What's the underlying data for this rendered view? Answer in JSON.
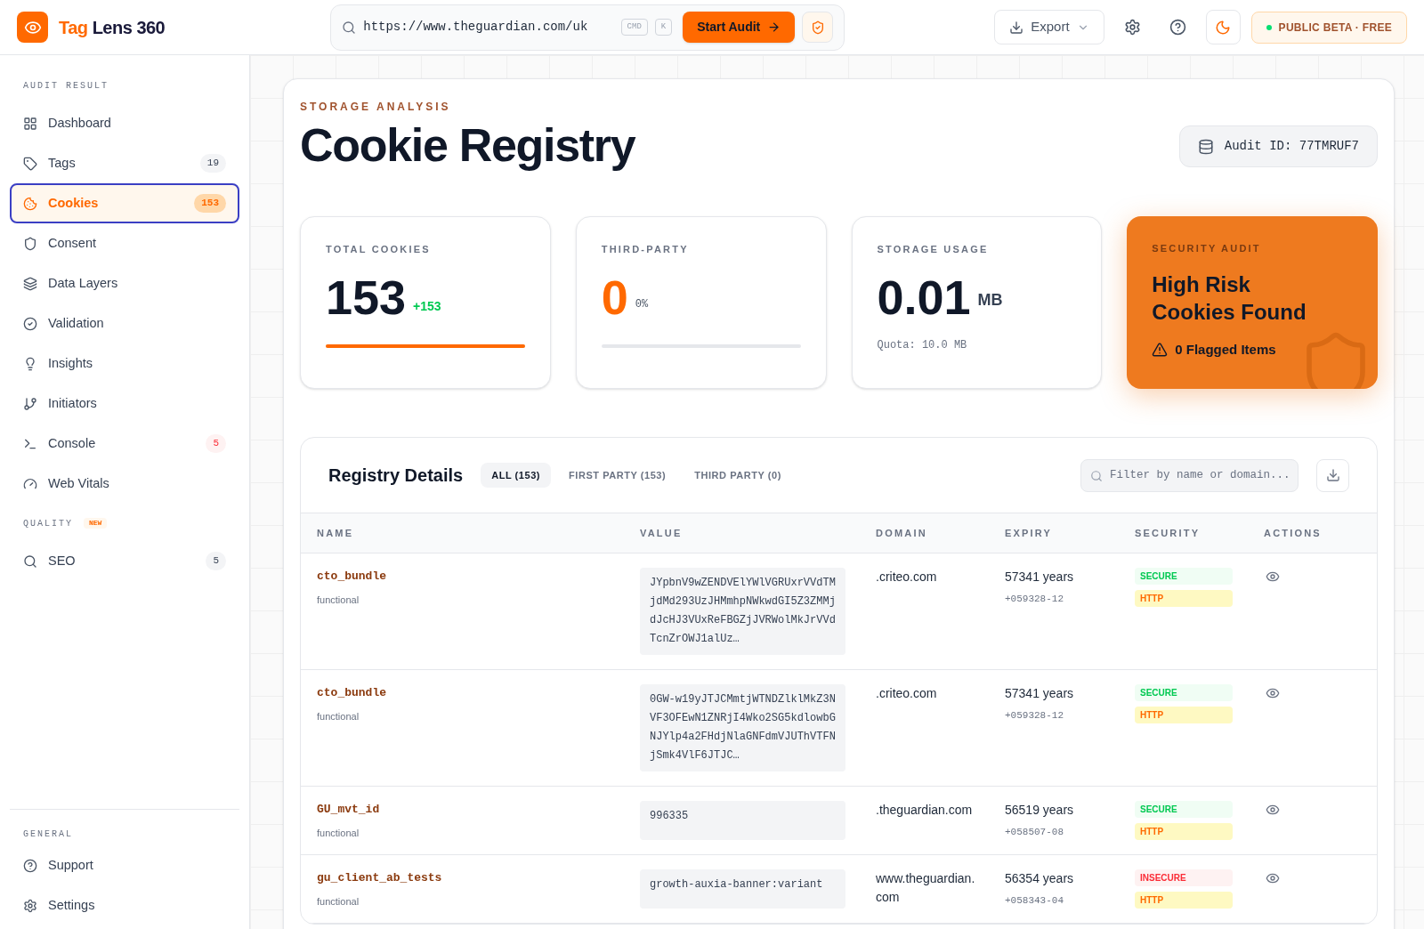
{
  "brand": {
    "first": "Tag",
    "second": "Lens 360"
  },
  "url_bar": {
    "value": "https://www.theguardian.com/uk",
    "keys": [
      "CMD",
      "K"
    ],
    "button": "Start Audit"
  },
  "header_actions": {
    "export": "Export",
    "beta": "PUBLIC BETA · FREE"
  },
  "sidebar": {
    "sections": [
      {
        "title": "AUDIT RESULT",
        "items": [
          {
            "label": "Dashboard",
            "selected": false
          },
          {
            "label": "Tags",
            "selected": false,
            "badge": {
              "text": "19",
              "kind": "neutral"
            }
          },
          {
            "label": "Cookies",
            "selected": true,
            "badge": {
              "text": "153",
              "kind": "neutral"
            }
          },
          {
            "label": "Consent",
            "selected": false
          },
          {
            "label": "Data Layers",
            "selected": false
          },
          {
            "label": "Validation",
            "selected": false
          },
          {
            "label": "Insights",
            "selected": false
          },
          {
            "label": "Initiators",
            "selected": false
          },
          {
            "label": "Console",
            "selected": false,
            "badge": {
              "text": "5",
              "kind": "alert"
            }
          },
          {
            "label": "Web Vitals",
            "selected": false
          }
        ]
      },
      {
        "title": "QUALITY",
        "tag": "NEW",
        "items": [
          {
            "label": "SEO",
            "selected": false,
            "badge": {
              "text": "5",
              "kind": "neutral"
            }
          }
        ]
      }
    ],
    "footer": {
      "title": "GENERAL",
      "items": [
        {
          "label": "Support",
          "selected": false
        },
        {
          "label": "Settings",
          "selected": false
        }
      ]
    }
  },
  "page": {
    "eyebrow": "STORAGE ANALYSIS",
    "title": "Cookie Registry",
    "audit_id": "Audit ID: 77TMRUF7"
  },
  "stats": [
    {
      "kind": "bar",
      "label": "TOTAL COOKIES",
      "value": "153",
      "delta": "+153",
      "level": 1
    },
    {
      "kind": "segments",
      "label": "THIRD-PARTY",
      "value": "0",
      "unit": "0%",
      "level": 0
    },
    {
      "kind": "quota",
      "label": "STORAGE USAGE",
      "value": "0.01",
      "unit": "MB",
      "note": "Quota: 10.0 MB"
    },
    {
      "kind": "alert",
      "label": "SECURITY AUDIT",
      "value": "High Risk Cookies Found",
      "note": "0 Flagged Items"
    }
  ],
  "registry": {
    "title": "Registry Details",
    "tabs": [
      {
        "label": "ALL (153)",
        "selected": true
      },
      {
        "label": "FIRST PARTY (153)",
        "selected": false
      },
      {
        "label": "THIRD PARTY (0)",
        "selected": false
      }
    ],
    "filter": {
      "placeholder": "Filter by name or domain..."
    },
    "columns": [
      "NAME",
      "VALUE",
      "DOMAIN",
      "EXPIRY",
      "SECURITY",
      "ACTIONS"
    ],
    "rows": [
      {
        "name": "cto_bundle",
        "category": "functional",
        "value": "JYpbnV9wZENDVElYWlVGRUxrVVdTMjdMd293UzJHMmhpNWkwdGI5Z3ZMMjdJcHJ3VUxReFBGZjJVRWolMkJrVVdTcnZrOWJ1alUz…",
        "domain": ".criteo.com",
        "expiry": "57341 years",
        "expiry_date": "+059328-12",
        "flags": [
          {
            "text": "SECURE",
            "kind": "secure"
          },
          {
            "text": "HTTP",
            "kind": "http"
          }
        ]
      },
      {
        "name": "cto_bundle",
        "category": "functional",
        "value": "0GW-w19yJTJCMmtjWTNDZlklMkZ3NVF3OFEwN1ZNRjI4Wko2SG5kdlowbGNJYlp4a2FHdjNlaGNFdmVJUThVTFNjSmk4VlF6JTJC…",
        "domain": ".criteo.com",
        "expiry": "57341 years",
        "expiry_date": "+059328-12",
        "flags": [
          {
            "text": "SECURE",
            "kind": "secure"
          },
          {
            "text": "HTTP",
            "kind": "http"
          }
        ]
      },
      {
        "name": "GU_mvt_id",
        "category": "functional",
        "value": "996335",
        "domain": ".theguardian.com",
        "expiry": "56519 years",
        "expiry_date": "+058507-08",
        "flags": [
          {
            "text": "SECURE",
            "kind": "secure"
          },
          {
            "text": "HTTP",
            "kind": "http"
          }
        ]
      },
      {
        "name": "gu_client_ab_tests",
        "category": "functional",
        "value": "growth-auxia-banner:variant",
        "domain": "www.theguardian.com",
        "expiry": "56354 years",
        "expiry_date": "+058343-04",
        "flags": [
          {
            "text": "INSECURE",
            "kind": "insecure"
          },
          {
            "text": "HTTP",
            "kind": "http"
          }
        ]
      }
    ]
  }
}
